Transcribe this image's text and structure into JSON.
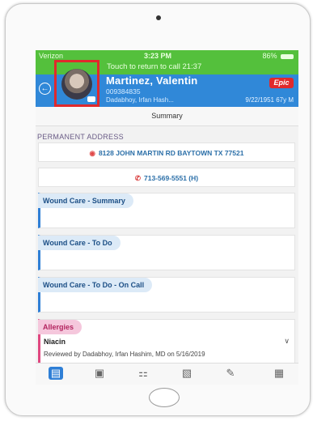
{
  "status": {
    "carrier": "Verizon",
    "time": "3:23 PM",
    "battery": "86%",
    "call_banner": "Touch to return to call 21:37"
  },
  "patient": {
    "name": "Martinez, Valentin",
    "mrn": "009384835",
    "pcp": "Dadabhoy, Irfan Hash...",
    "dob_age": "9/22/1951 67y M",
    "brand": "Epic"
  },
  "tabs": {
    "active_label": "Summary"
  },
  "address": {
    "section_label": "PERMANENT ADDRESS",
    "line": "8128 JOHN MARTIN RD BAYTOWN TX 77521",
    "phone": "713-569-5551 (H)"
  },
  "cards": [
    {
      "title": "Wound Care - Summary"
    },
    {
      "title": "Wound Care - To Do"
    },
    {
      "title": "Wound Care - To Do - On Call"
    }
  ],
  "allergies": {
    "title": "Allergies",
    "item": "Niacin",
    "reviewed": "Reviewed by Dadabhoy, Irfan Hashim, MD on 5/16/2019"
  },
  "bottom_icons": [
    "summary-icon",
    "chart-review-icon",
    "care-team-icon",
    "notes-icon",
    "write-note-icon",
    "media-icon"
  ],
  "colors": {
    "status_green": "#54c03c",
    "header_blue": "#3088d8",
    "highlight_red": "#e0292c",
    "wound_accent": "#2f7fd6",
    "allergy_accent": "#e04880"
  }
}
